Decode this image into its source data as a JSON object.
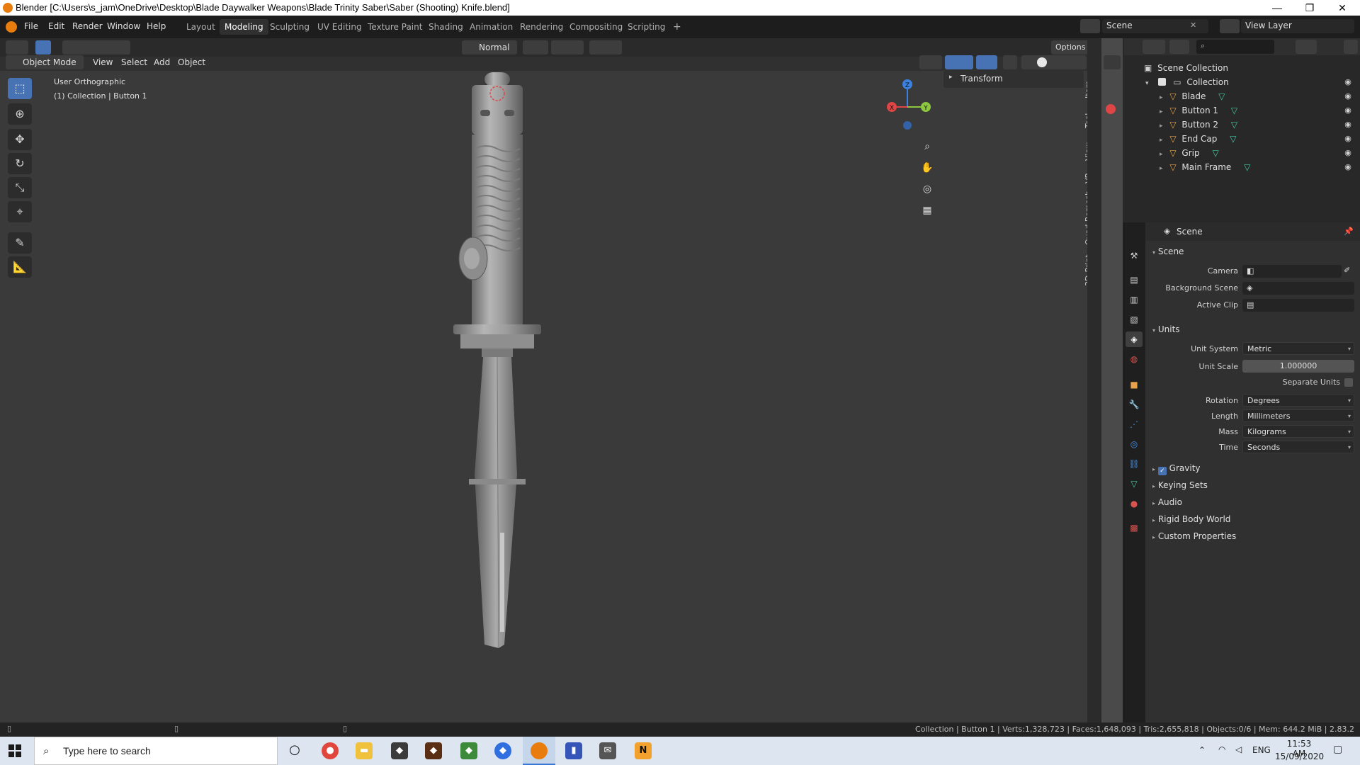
{
  "window": {
    "title": "Blender [C:\\Users\\s_jam\\OneDrive\\Desktop\\Blade Daywalker Weapons\\Blade Trinity Saber\\Saber (Shooting) Knife.blend]",
    "minimize": "—",
    "restore": "❐",
    "close": "✕"
  },
  "menu": [
    "File",
    "Edit",
    "Render",
    "Window",
    "Help"
  ],
  "workspaces": [
    "Layout",
    "Modeling",
    "Sculpting",
    "UV Editing",
    "Texture Paint",
    "Shading",
    "Animation",
    "Rendering",
    "Compositing",
    "Scripting"
  ],
  "workspace_add": "+",
  "active_workspace": "Modeling",
  "scene_selector": "Scene",
  "view_layer_selector": "View Layer",
  "viewport": {
    "orientation": "Normal",
    "options_label": "Options",
    "mode": "Object Mode",
    "header_menu": [
      "View",
      "Select",
      "Add",
      "Object"
    ],
    "overlay_view_name": "User Orthographic",
    "overlay_context": "(1) Collection | Button 1",
    "n_panel_section": "Transform",
    "side_tabs": [
      "Item",
      "Tool",
      "View",
      "VR",
      "Quad Remesh",
      "3D-Print"
    ],
    "gizmo": {
      "z": "Z",
      "y": "Y",
      "x": "X"
    }
  },
  "outliner": {
    "root": "Scene Collection",
    "collection": "Collection",
    "objects": [
      "Blade",
      "Button 1",
      "Button 2",
      "End Cap",
      "Grip",
      "Main Frame"
    ]
  },
  "properties": {
    "header": "Scene",
    "scene_section": "Scene",
    "camera_label": "Camera",
    "background_scene_label": "Background Scene",
    "active_clip_label": "Active Clip",
    "units_section": "Units",
    "unit_system_label": "Unit System",
    "unit_system": "Metric",
    "unit_scale_label": "Unit Scale",
    "unit_scale": "1.000000",
    "separate_units_label": "Separate Units",
    "rotation_label": "Rotation",
    "rotation": "Degrees",
    "length_label": "Length",
    "length": "Millimeters",
    "mass_label": "Mass",
    "mass": "Kilograms",
    "time_label": "Time",
    "time": "Seconds",
    "collapsed_sections": [
      "Gravity",
      "Keying Sets",
      "Audio",
      "Rigid Body World",
      "Custom Properties"
    ]
  },
  "status_bar": "Collection | Button 1 | Verts:1,328,723 | Faces:1,648,093 | Tris:2,655,818 | Objects:0/6 | Mem: 644.2 MiB | 2.83.2",
  "taskbar": {
    "search_placeholder": "Type here to search",
    "language": "ENG",
    "time": "11:53 AM",
    "date": "15/09/2020"
  },
  "colors": {
    "accent": "#4772b3",
    "blender_orange": "#e87d0d",
    "axis_x": "#e04545",
    "axis_y": "#8dc63f",
    "axis_z": "#3b82e0"
  }
}
